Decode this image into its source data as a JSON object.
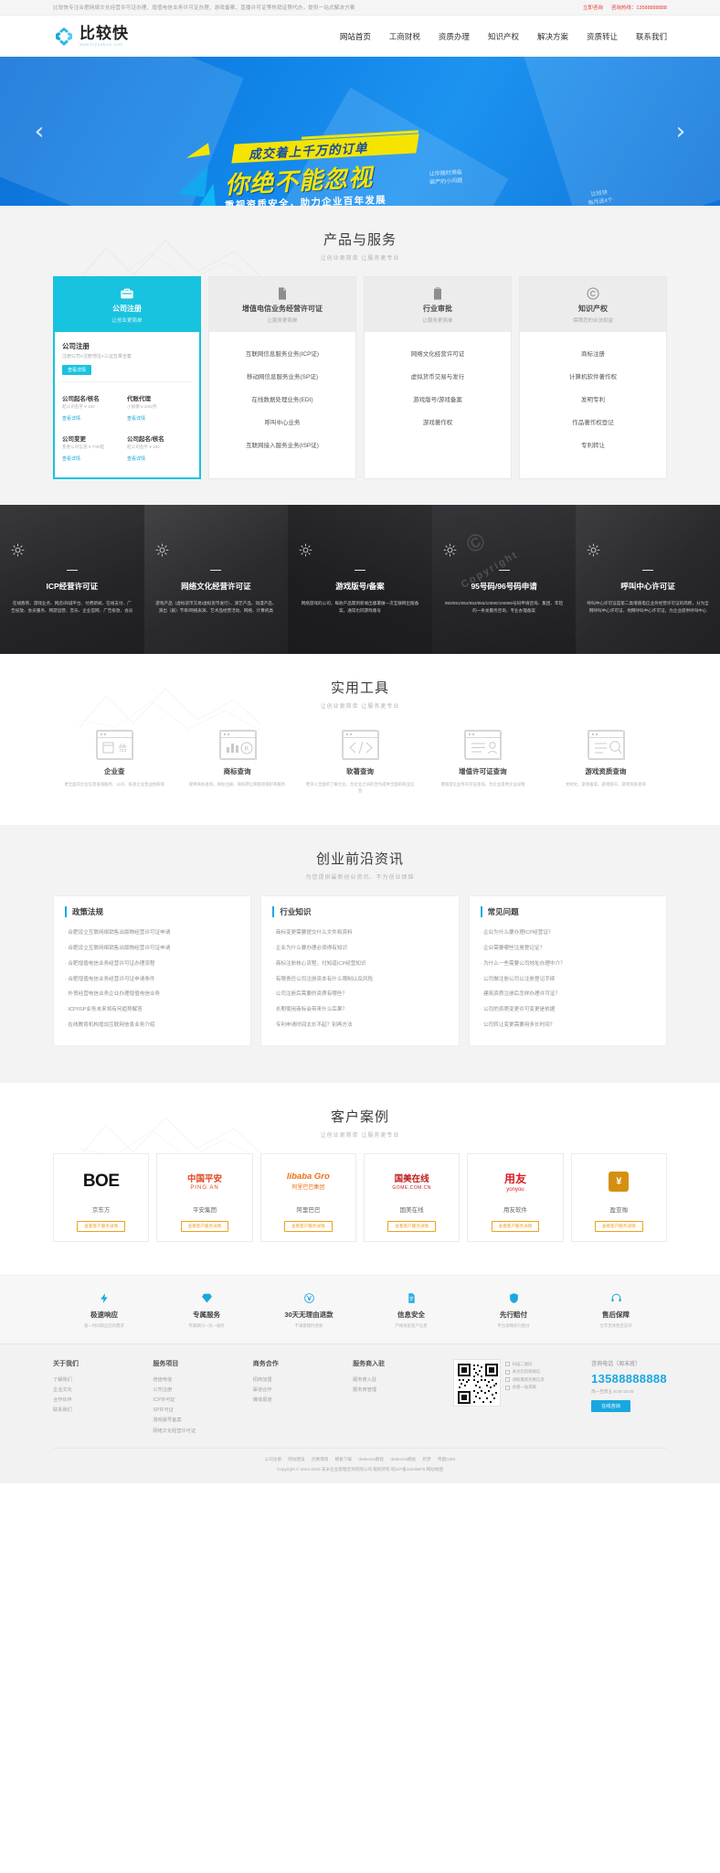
{
  "topbar": {
    "notice": "比较快专注合肥网络文化经营许可证办理、增值电信业务许可证办理、游戏备案、直播许可证等热销证照代办，提供一站式解决方案",
    "consult_label": "立即咨询",
    "phone_label": "咨询热线：13588888888"
  },
  "header": {
    "logo_title": "比较快",
    "logo_sub": "www.bijiaokuai.com",
    "nav": [
      {
        "label": "网站首页"
      },
      {
        "label": "工商财税"
      },
      {
        "label": "资质办理"
      },
      {
        "label": "知识产权"
      },
      {
        "label": "解决方案"
      },
      {
        "label": "资质转让"
      },
      {
        "label": "联系我们"
      }
    ]
  },
  "banner": {
    "line1": "成交着上千万的订单",
    "line2": "你绝不能忽视",
    "side": "让你随时濒临\n破产的小问题",
    "line3": "重视资质安全，助力企业百年发展",
    "stamp": "比较快\n每月送4个",
    "prev_icon": "chevron-left-icon",
    "next_icon": "chevron-right-icon"
  },
  "products": {
    "title": "产品与服务",
    "subtitle": "让创业更简单 让服务更专业",
    "cards": [
      {
        "name": "公司注册",
        "tag": "让创业更简单",
        "icon": "briefcase-icon",
        "active": true,
        "main": {
          "title": "公司注册",
          "desc": "注册公司+注册地址+三证五章全套",
          "btn": "查看详情"
        },
        "items": [
          {
            "title": "公司起名/核名",
            "price": "起公司名字 ¥ 100",
            "link": "查看详情"
          },
          {
            "title": "代账代理",
            "price": "小规模 ¥ 200/月",
            "link": "查看详情"
          },
          {
            "title": "公司变更",
            "price": "变更公司信息 ¥ 700/起",
            "link": "查看详情"
          },
          {
            "title": "公司起名/核名",
            "price": "起公司名字 ¥ 100",
            "link": "查看详情"
          }
        ]
      },
      {
        "name": "增值电信业务经营许可证",
        "tag": "让服务更简单",
        "icon": "document-icon",
        "active": false,
        "items": [
          {
            "label": "互联网信息服务业务(ICP证)"
          },
          {
            "label": "移动网信息服务业务(SP证)"
          },
          {
            "label": "在线数据处理业务(EDI)"
          },
          {
            "label": "呼叫中心业务"
          },
          {
            "label": "互联网接入服务业务(ISP证)"
          }
        ]
      },
      {
        "name": "行业审批",
        "tag": "让服务更简单",
        "icon": "clipboard-icon",
        "active": false,
        "items": [
          {
            "label": "网络文化经营许可证"
          },
          {
            "label": "虚拟货币交易与发行"
          },
          {
            "label": "游戏版号/游戏备案"
          },
          {
            "label": "游戏著作权"
          }
        ]
      },
      {
        "name": "知识产权",
        "tag": "保障您的合法权益",
        "icon": "copyright-icon",
        "active": false,
        "items": [
          {
            "label": "商标注册"
          },
          {
            "label": "计算机软件著作权"
          },
          {
            "label": "发明专利"
          },
          {
            "label": "作品著作权登记"
          },
          {
            "label": "专利转让"
          }
        ]
      }
    ]
  },
  "gallery": [
    {
      "title": "ICP经营许可证",
      "desc": "在线教育、游戏业务、网店/商城平台、付费新闻、在线支付、广告投放、会员服务、网游运营、音乐、企业官网、广告投放、会员",
      "icon": "sun-icon"
    },
    {
      "title": "网络文化经营许可证",
      "desc": "游戏产品（虚拟货币交易/虚拟货币发行）、演艺产品、动漫产品、演出（剧）节目/网络表演、艺术品经营活动、网络、计算机类",
      "icon": "sun-icon"
    },
    {
      "title": "游戏版号/备案",
      "desc": "网络游戏的公司，每款产品需到新闻出版署做一次互联网出版备案，通常也同游戏版号",
      "icon": "sun-icon"
    },
    {
      "title": "95号码/96号码申请",
      "desc": "950/951/952/953/955/10690/106980号码申请咨询、集团、年检的一条龙服务咨询，专业办理备案",
      "icon": "sun-icon"
    },
    {
      "title": "呼叫中心许可证",
      "desc": "呼叫中心许可证是第二类增值电信业务经营许可证的简称，分为全网呼叫中心许可证、地网呼叫中心许可证，为企业提供呼叫中心",
      "icon": "sun-icon"
    }
  ],
  "tools": {
    "title": "实用工具",
    "subtitle": "让创业更简单 让服务更专业",
    "items": [
      {
        "name": "企业查",
        "desc": "更全面的企业信息查询服务：公司、核查企业营业执照等",
        "icon": "window-box-icon"
      },
      {
        "name": "商标查询",
        "desc": "提供商标查询，商标注册，商标转让和版权保护等服务",
        "icon": "chart-doc-icon"
      },
      {
        "name": "软著查询",
        "desc": "更深入全面的了解企业，为企业之间的合作提供全面的商业信息",
        "icon": "code-doc-icon"
      },
      {
        "name": "增值许可证查询",
        "desc": "增值电信业务许可证查询，为企业提供企业详情",
        "icon": "user-doc-icon"
      },
      {
        "name": "游戏资质查询",
        "desc": "文网文、游戏备案、游戏版号、游戏资质查询",
        "icon": "search-doc-icon"
      }
    ]
  },
  "news": {
    "title": "创业前沿资讯",
    "subtitle": "为您提供最新创业资讯、不为创业烦恼",
    "columns": [
      {
        "title": "政策法规",
        "items": [
          "合肥设立互联网络销售出版物经营许可证申请",
          "合肥设立互联网络销售出版物经营许可证申请",
          "合肥增值电信业务经营许可证办理流程",
          "合肥增值电信业务经营许可证申请条件",
          "外贸经营电信业务企业办理增值电信业务",
          "ICP/ISP业务未来将有何趋势解答",
          "在线教育机构增加互联网信息业务介绍"
        ]
      },
      {
        "title": "行业知识",
        "items": [
          "商标变更需要提交什么文件和资料",
          "企业为什么要办理必须得有知识",
          "商标注册核心流程，付知道ICP经营知识",
          "有限责任公司注册资本有什么限制以及风险",
          "公司注册后需要的资质有哪些？",
          "长期使用商标会带来什么后果？",
          "专利申请时间太长不起？别再方法"
        ]
      },
      {
        "title": "常见问题",
        "items": [
          "企业为什么要办理ICP经营证？",
          "企业需要哪些注册登记证？",
          "为什么一些需要公司地址办理中介？",
          "公司做注册公司以注册登记手续",
          "建筑资质注册后怎样办理许可证？",
          "公司的资质变更许可变更是依据",
          "公司转让变更需要用多长时间？"
        ]
      }
    ]
  },
  "cases": {
    "title": "客户案例",
    "subtitle": "让创业更简单 让服务更专业",
    "btn_label": "查看客户服务详情",
    "items": [
      {
        "logo_text": "BOE",
        "logo_sub": "",
        "name": "京东方",
        "color": "#111111"
      },
      {
        "logo_text": "中国平安",
        "logo_sub": "PING AN",
        "name": "平安集团",
        "color": "#e0471f"
      },
      {
        "logo_text": "libaba Gro",
        "logo_sub": "阿里巴巴集团",
        "name": "阿里巴巴",
        "color": "#e8711a"
      },
      {
        "logo_text": "国美在线",
        "logo_sub": "GOME.COM.CN",
        "name": "国美在线",
        "color": "#c01c1c"
      },
      {
        "logo_text": "用友",
        "logo_sub": "yonyou",
        "name": "用友软件",
        "color": "#d81e24"
      },
      {
        "logo_text": "盈亚咖",
        "logo_sub": "",
        "name": "盈亚咖",
        "color": "#d4900f"
      }
    ]
  },
  "features": [
    {
      "name": "极速响应",
      "desc": "第一时间响应您的需求",
      "icon": "lightning-icon"
    },
    {
      "name": "专属服务",
      "desc": "专属顾问一对一服务",
      "icon": "diamond-icon"
    },
    {
      "name": "30天无理由退款",
      "desc": "不满意随时退款",
      "icon": "yuan-refund-icon"
    },
    {
      "name": "信息安全",
      "desc": "严格保密客户信息",
      "icon": "shield-doc-icon"
    },
    {
      "name": "先行赔付",
      "desc": "平台保障先行赔付",
      "icon": "shield-icon"
    },
    {
      "name": "售后保障",
      "desc": "全年无休售后支持",
      "icon": "headset-icon"
    }
  ],
  "footer": {
    "columns": [
      {
        "title": "关于我们",
        "items": [
          "了解我们",
          "企业文化",
          "合作伙伴",
          "联系我们"
        ]
      },
      {
        "title": "服务项目",
        "items": [
          "增值电信",
          "公司注册",
          "ICP许可证",
          "SP许可证",
          "游戏版号备案",
          "网络文化经营许可证"
        ]
      },
      {
        "title": "商务合作",
        "items": [
          "招商加盟",
          "渠道合作",
          "媒体报道"
        ]
      },
      {
        "title": "服务商入驻",
        "items": [
          "服务商入驻",
          "服务商管理"
        ]
      }
    ],
    "qr_notes": [
      "扫描二维码",
      "关注比较快微信",
      "领取最新优惠信息",
      "办理一站来稿"
    ],
    "contact": {
      "label": "咨询电话（周末班）",
      "phone": "13588888888",
      "hours": "周一至周五 8:00-18:00",
      "btn": "在线咨询"
    },
    "bottom_links": [
      "公司注册",
      "网站建设",
      "优惠增值",
      "模板下载",
      "dedecms教程",
      "dedecms模板",
      "织梦",
      "帝国CMS"
    ],
    "copyright": "Copyright © 2012-2019 安米企业管理咨询有限公司 版权所有  皖ICP备12345678  网站地图"
  }
}
